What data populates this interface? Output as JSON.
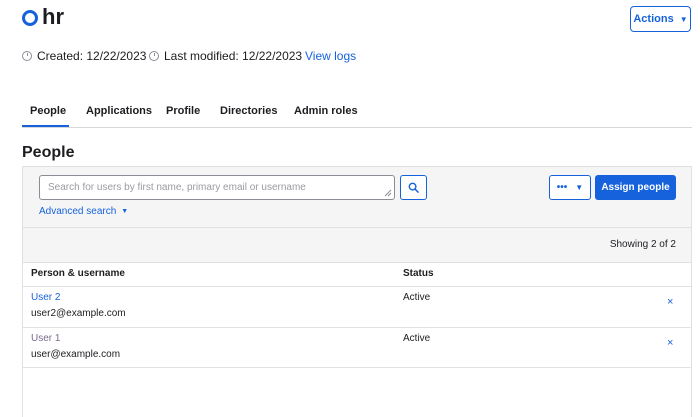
{
  "header": {
    "title": "hr",
    "actions_label": "Actions"
  },
  "meta": {
    "created": "Created: 12/22/2023",
    "modified": "Last modified: 12/22/2023",
    "view_logs": "View logs"
  },
  "tabs": [
    {
      "label": "People",
      "active": true
    },
    {
      "label": "Applications"
    },
    {
      "label": "Profile"
    },
    {
      "label": "Directories"
    },
    {
      "label": "Admin roles"
    }
  ],
  "section": {
    "title": "People",
    "search_placeholder": "Search for users by first name, primary email or username",
    "advanced_search": "Advanced search",
    "more_label": "•••",
    "assign_label": "Assign people",
    "showing": "Showing 2 of 2"
  },
  "table": {
    "columns": [
      "Person & username",
      "Status"
    ],
    "rows": [
      {
        "name": "User 2",
        "email": "user2@example.com",
        "status": "Active",
        "remove": "×"
      },
      {
        "name": "User 1",
        "email": "user@example.com",
        "status": "Active",
        "remove": "×"
      }
    ]
  },
  "colors": {
    "accent": "#1662dd",
    "toolbar_bg": "#f5f5f6",
    "border": "#e1e1e5"
  }
}
